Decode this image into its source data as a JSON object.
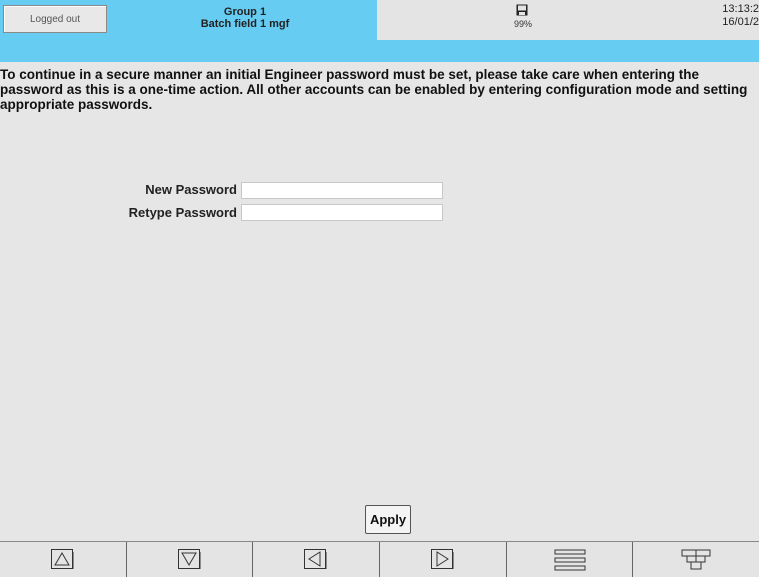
{
  "header": {
    "login_status": "Logged out",
    "group_name": "Group 1",
    "batch_field": "Batch field 1 mgf",
    "disk_usage": "99%",
    "time": "13:13:2",
    "date": "16/01/2"
  },
  "message": "To continue in a secure manner an initial Engineer password must be set, please take care when entering the password as this is a one-time action. All other accounts can be enabled by entering configuration mode and setting appropriate passwords.",
  "form": {
    "new_password_label": "New Password",
    "new_password_value": "",
    "retype_password_label": "Retype Password",
    "retype_password_value": "",
    "apply_label": "Apply"
  },
  "navbar": {
    "buttons": [
      "up-arrow-icon",
      "down-arrow-icon",
      "left-arrow-icon",
      "right-arrow-icon",
      "menu-icon",
      "grid-icon"
    ]
  },
  "colors": {
    "accent": "#66ccf2",
    "background": "#e6e6e6"
  }
}
